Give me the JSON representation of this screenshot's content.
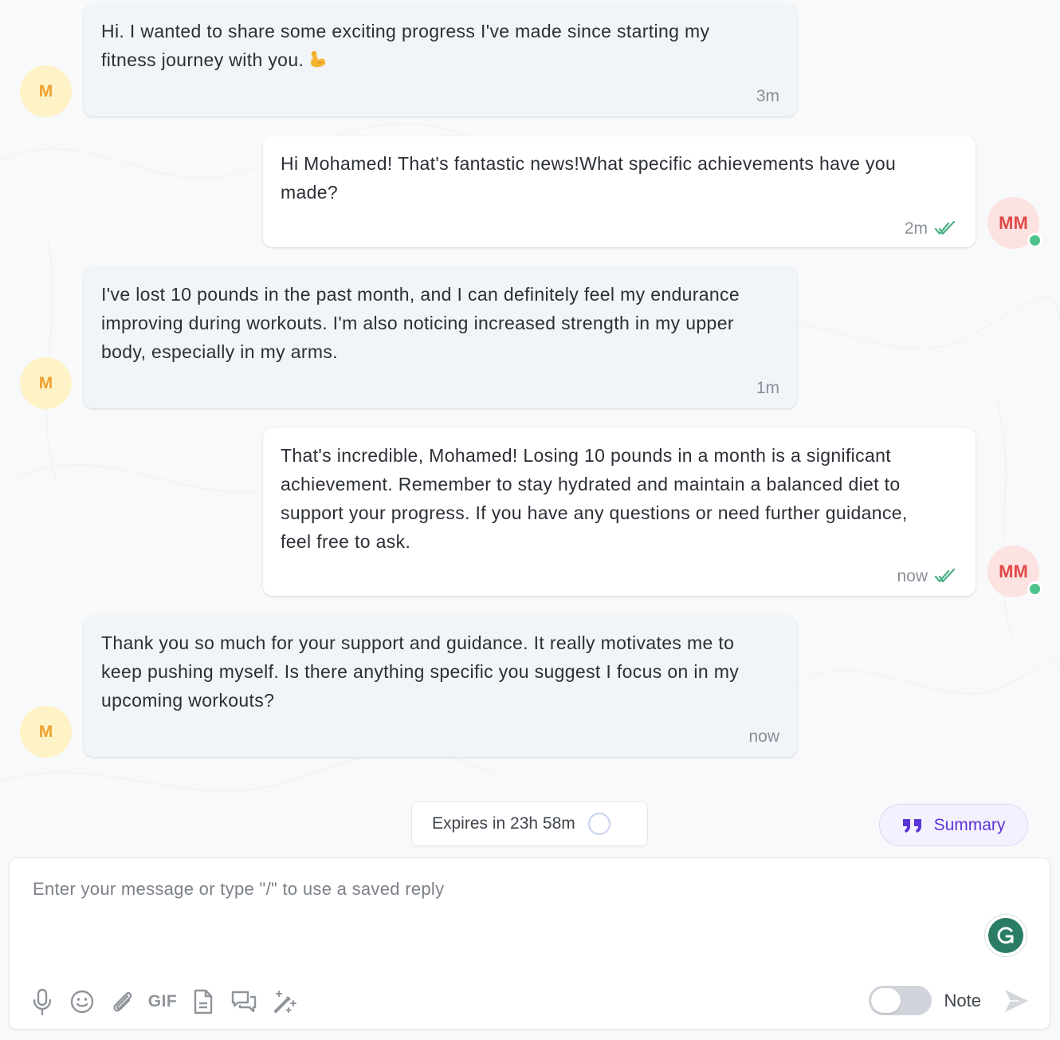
{
  "colors": {
    "accent": "#5b34d6",
    "read_check": "#4caf85",
    "online": "#4cc38a",
    "contact_avatar_bg": "#fef3c7",
    "contact_avatar_fg": "#f0a030",
    "agent_avatar_bg": "#fde2e2",
    "agent_avatar_fg": "#e04848"
  },
  "messages": [
    {
      "direction": "incoming",
      "avatar": "M",
      "text": "Hi. I wanted to share some exciting progress I've made since starting my\nfitness journey with you.",
      "emoji": "flexed-biceps",
      "time": "3m"
    },
    {
      "direction": "outgoing",
      "avatar": "MM",
      "text": "Hi Mohamed! That's fantastic news!What specific achievements have you\nmade?",
      "time": "2m",
      "status": "read",
      "online": true
    },
    {
      "direction": "incoming",
      "avatar": "M",
      "text": "I've lost 10 pounds in the past month, and I can definitely feel my endurance\nimproving during workouts. I'm also noticing increased strength in my upper\nbody, especially in my arms.",
      "time": "1m"
    },
    {
      "direction": "outgoing",
      "avatar": "MM",
      "text": "That's incredible, Mohamed! Losing 10 pounds in a month is a significant\nachievement. Remember to stay hydrated and maintain a balanced diet to\nsupport your progress. If you have any questions or need further guidance,\nfeel free to ask.",
      "time": "now",
      "status": "read",
      "online": true
    },
    {
      "direction": "incoming",
      "avatar": "M",
      "text": "Thank you so much for your support and guidance. It really motivates me to\nkeep pushing myself. Is there anything specific you suggest I focus on in my\nupcoming workouts?",
      "time": "now"
    }
  ],
  "expiry": {
    "label": "Expires in 23h 58m",
    "icon": "timer-ring-icon"
  },
  "summary": {
    "label": "Summary",
    "icon": "quote-icon"
  },
  "composer": {
    "value": "",
    "placeholder": "Enter your message or type \"/\" to use a saved reply",
    "tools": [
      {
        "name": "microphone-icon"
      },
      {
        "name": "emoji-icon"
      },
      {
        "name": "attachment-icon"
      },
      {
        "name": "gif-icon",
        "label": "GIF"
      },
      {
        "name": "document-icon"
      },
      {
        "name": "saved-replies-icon"
      },
      {
        "name": "magic-wand-icon"
      }
    ],
    "note_label": "Note",
    "note_enabled": false,
    "grammarly_icon": "grammarly-icon",
    "send_icon": "send-icon"
  }
}
